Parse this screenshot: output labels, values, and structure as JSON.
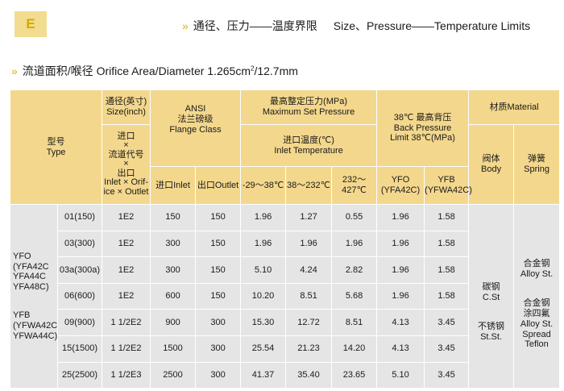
{
  "header": {
    "badge": "E",
    "title_cn": "通径、压力——温度界限",
    "title_en": "Size、Pressure——Temperature Limits"
  },
  "section": {
    "title_main": "流道面积/喉径 Orifice Area/Diameter 1.265cm",
    "title_sup": "2",
    "title_end": "/12.7mm"
  },
  "table": {
    "head": {
      "type_cn": "型号",
      "type_en": "Type",
      "size_cn": "通径(英寸)",
      "size_en": "Size(inch)",
      "inlet_code_lines": [
        "进口",
        "×",
        "流道代号",
        "×",
        "出口",
        "Inlet × Orif-",
        "ice × Outlet"
      ],
      "ansi_1": "ANSI",
      "ansi_2": "法兰磅级",
      "ansi_3": "Flange Class",
      "set_cn": "最高整定压力(MPa)",
      "set_en": "Maximum Set Pressure",
      "temp_cn": "进口温度(℃)",
      "temp_en": "Inlet Temperature",
      "back_1": "38℃ 最高背压",
      "back_2": "Back Pressure",
      "back_3": "Limit 38℃(MPa)",
      "material": "材质Material",
      "inlet": "进口Inlet",
      "outlet": "出口Outlet",
      "t1": "-29～38℃",
      "t2": "38～232℃",
      "t3": "232～427℃",
      "yfo_1": "YFO",
      "yfo_2": "(YFA42C)",
      "yfb_1": "YFB",
      "yfb_2": "(YFWA42C)",
      "body_cn": "阀体",
      "body_en": "Body",
      "spring_cn": "弹簧",
      "spring_en": "Spring"
    },
    "type_lines": [
      "YFO",
      "(YFA42C",
      "YFA44C",
      "YFA48C)",
      "",
      "YFB",
      "(YFWA42C",
      "YFWA44C)"
    ],
    "body_material_lines": [
      "碳钢",
      "C.St",
      "",
      "不锈钢",
      "St.St."
    ],
    "spring_material_lines": [
      "合金钢",
      "Alloy St.",
      "",
      "合金钢",
      "涂四氟",
      "Alloy St.",
      "Spread",
      "Teflon"
    ],
    "rows": [
      [
        "01(150)",
        "1E2",
        "150",
        "150",
        "1.96",
        "1.27",
        "0.55",
        "1.96",
        "1.58"
      ],
      [
        "03(300)",
        "1E2",
        "300",
        "150",
        "1.96",
        "1.96",
        "1.96",
        "1.96",
        "1.58"
      ],
      [
        "03a(300a)",
        "1E2",
        "300",
        "150",
        "5.10",
        "4.24",
        "2.82",
        "1.96",
        "1.58"
      ],
      [
        "06(600)",
        "1E2",
        "600",
        "150",
        "10.20",
        "8.51",
        "5.68",
        "1.96",
        "1.58"
      ],
      [
        "09(900)",
        "1 1/2E2",
        "900",
        "300",
        "15.30",
        "12.72",
        "8.51",
        "4.13",
        "3.45"
      ],
      [
        "15(1500)",
        "1 1/2E2",
        "1500",
        "300",
        "25.54",
        "21.23",
        "14.20",
        "4.13",
        "3.45"
      ],
      [
        "25(2500)",
        "1 1/2E3",
        "2500",
        "300",
        "41.37",
        "35.40",
        "23.65",
        "5.10",
        "3.45"
      ]
    ]
  }
}
